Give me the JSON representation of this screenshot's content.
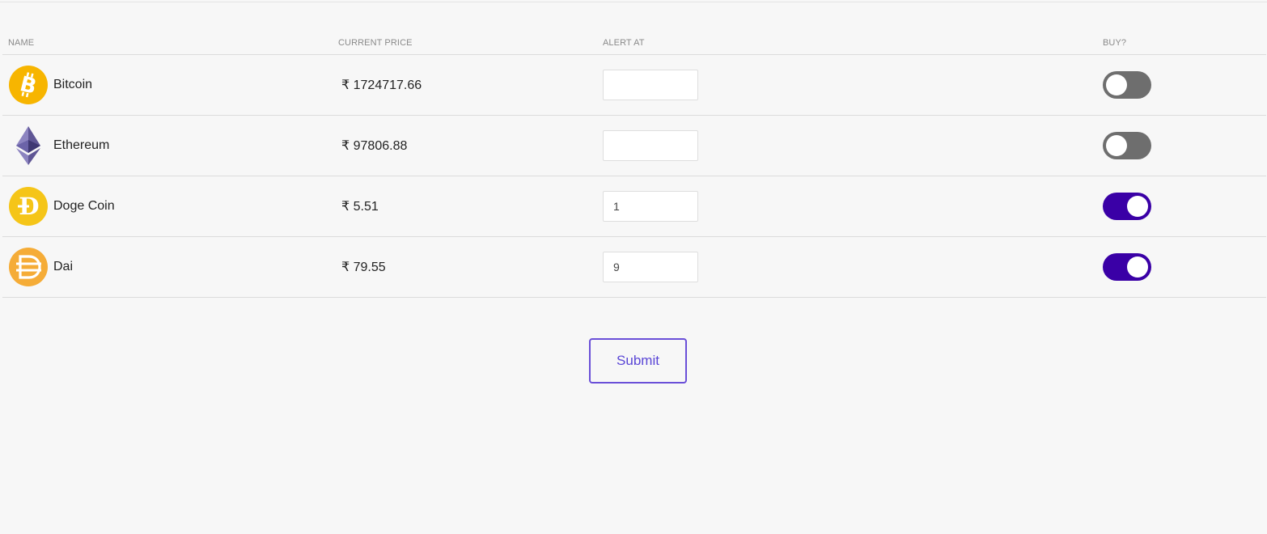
{
  "table": {
    "headers": {
      "name": "NAME",
      "price": "CURRENT PRICE",
      "alert": "ALERT AT",
      "buy": "BUY?"
    },
    "currency_symbol": "₹",
    "rows": [
      {
        "name": "Bitcoin",
        "price": "₹ 1724717.66",
        "alert_value": "",
        "buy": false,
        "icon": "bitcoin-icon",
        "icon_color": "#f7b500"
      },
      {
        "name": "Ethereum",
        "price": "₹ 97806.88",
        "alert_value": "",
        "buy": false,
        "icon": "ethereum-icon",
        "icon_color": "#6b5fa6"
      },
      {
        "name": "Doge Coin",
        "price": "₹ 5.51",
        "alert_value": "1",
        "buy": true,
        "icon": "dogecoin-icon",
        "icon_color": "#f5c518"
      },
      {
        "name": "Dai",
        "price": "₹ 79.55",
        "alert_value": "9",
        "buy": true,
        "icon": "dai-icon",
        "icon_color": "#f5ac37"
      }
    ]
  },
  "toggle_colors": {
    "on": "#3a00a6",
    "off": "#6e6e6e"
  },
  "submit": {
    "label": "Submit",
    "color": "#5a46d6"
  }
}
